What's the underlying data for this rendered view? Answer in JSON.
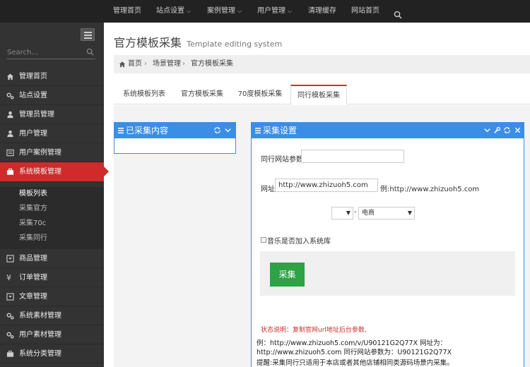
{
  "topnav": {
    "items": [
      {
        "label": "管理首页",
        "has_caret": false
      },
      {
        "label": "站点设置",
        "has_caret": true
      },
      {
        "label": "案例管理",
        "has_caret": true
      },
      {
        "label": "用户管理",
        "has_caret": true
      },
      {
        "label": "清理缓存",
        "has_caret": false
      },
      {
        "label": "网站首页",
        "has_caret": false
      }
    ],
    "search_icon": "search-icon"
  },
  "sidebar": {
    "search_placeholder": "Search...",
    "items": [
      {
        "label": "管理首页",
        "icon": "home-icon"
      },
      {
        "label": "站点设置",
        "icon": "cogs-icon"
      },
      {
        "label": "管理员管理",
        "icon": "user-icon"
      },
      {
        "label": "用户管理",
        "icon": "user-icon"
      },
      {
        "label": "用户案例管理",
        "icon": "list-icon"
      },
      {
        "label": "系统模板管理",
        "icon": "briefcase-icon",
        "active": true
      },
      {
        "label": "商品管理",
        "icon": "dropdown-box-icon"
      },
      {
        "label": "订单管理",
        "icon": "yen-icon"
      },
      {
        "label": "文章管理",
        "icon": "dropdown-box-icon"
      },
      {
        "label": "系统素材管理",
        "icon": "cogs-icon"
      },
      {
        "label": "用户素材管理",
        "icon": "cogs-icon"
      },
      {
        "label": "系统分类管理",
        "icon": "briefcase-icon"
      }
    ],
    "subitems": [
      {
        "label": "模板列表",
        "current": true
      },
      {
        "label": "采集官方"
      },
      {
        "label": "采集70c"
      },
      {
        "label": "采集同行"
      }
    ]
  },
  "page": {
    "title": "官方模板采集",
    "subtitle": "Template editing system"
  },
  "breadcrumb": [
    "首页",
    "场景管理",
    "官方模板采集"
  ],
  "tabs": [
    {
      "label": "系统模板列表"
    },
    {
      "label": "官方模板采集"
    },
    {
      "label": "70度模板采集"
    },
    {
      "label": "同行模板采集",
      "active": true
    }
  ],
  "left_panel": {
    "title": "已采集内容"
  },
  "right_panel": {
    "title": "采集设置",
    "param_label": "同行网站参数:",
    "param_value": "",
    "url_label": "网址",
    "url_value": "http://www.zhizuoh5.com",
    "url_example": "例:http://www.zhizuoh5.com",
    "select_dash": "-",
    "category_value": "电商",
    "music_checkbox_label": "音乐是否加入系统库",
    "submit_label": "采集",
    "status_text": "状态说明：复制官网url地址后台参数,",
    "example_text": "例：http://www.zhizuoh5.com/v/U90121G2Q77X 网址为：http://www.zhizuoh5.com 同行网站参数为：U90121G2Q77X",
    "tip_text": "提醒:采集同行只适用于本店或者其他店铺相同类源码场景内采集。"
  },
  "colors": {
    "topbar": "#222222",
    "sidebar": "#333333",
    "active": "#d02a2a",
    "panel_header": "#3a8ee6",
    "submit": "#2ea244",
    "status_text": "#c9302c"
  }
}
